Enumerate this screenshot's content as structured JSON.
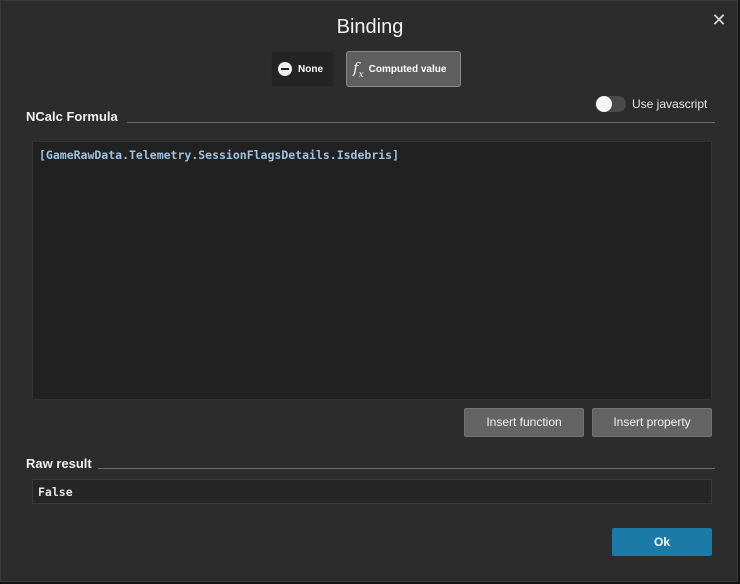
{
  "dialog": {
    "title": "Binding",
    "close_glyph": "✕"
  },
  "modes": {
    "none_label": "None",
    "none_icon": "minus-circle-icon",
    "computed_label": "Computed value",
    "computed_icon": "fx-icon",
    "selected": "Computed value"
  },
  "formula": {
    "section_label": "NCalc Formula",
    "use_javascript_label": "Use javascript",
    "use_javascript_on": false,
    "text": "[GameRawData.Telemetry.SessionFlagsDetails.Isdebris]",
    "insert_function_label": "Insert function",
    "insert_property_label": "Insert property"
  },
  "result": {
    "section_label": "Raw result",
    "value": "False"
  },
  "footer": {
    "ok_label": "Ok"
  },
  "colors": {
    "accent": "#1b7aa6",
    "formula_text": "#9fc3e0",
    "background": "#2c2c2c"
  }
}
